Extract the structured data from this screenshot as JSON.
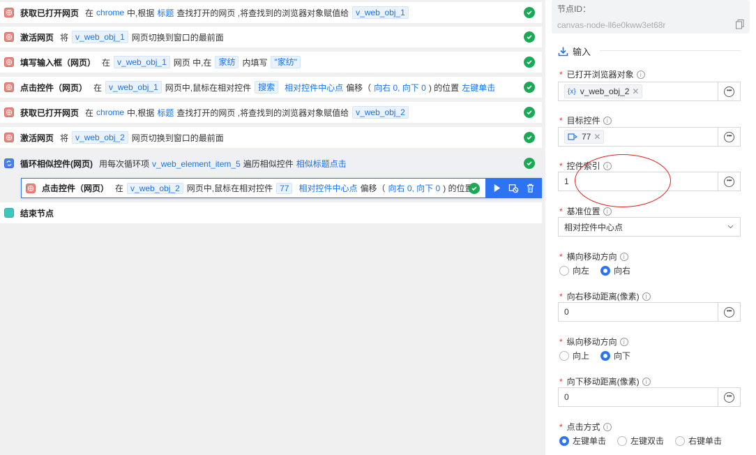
{
  "flow": {
    "rows": [
      {
        "title": "获取已打开网页",
        "parts": [
          [
            "t",
            "在"
          ],
          [
            "lnk",
            "chrome"
          ],
          [
            "t",
            "中,根据"
          ],
          [
            "lnk",
            "标题"
          ],
          [
            "t",
            "查找打开的网页 ,将查找到的浏览器对象赋值给"
          ],
          [
            "tag",
            "v_web_obj_1"
          ]
        ]
      },
      {
        "title": "激活网页",
        "parts": [
          [
            "t",
            "将"
          ],
          [
            "tag",
            "v_web_obj_1"
          ],
          [
            "t",
            "网页切换到窗口的最前面"
          ]
        ]
      },
      {
        "title": "填写输入框（网页）",
        "parts": [
          [
            "t",
            "在"
          ],
          [
            "tag",
            "v_web_obj_1"
          ],
          [
            "t",
            "网页 中,在"
          ],
          [
            "tag",
            "家纺"
          ],
          [
            "t",
            "内填写"
          ],
          [
            "tag",
            "\"家纺\""
          ]
        ]
      },
      {
        "title": "点击控件（网页）",
        "parts": [
          [
            "t",
            "在"
          ],
          [
            "tag",
            "v_web_obj_1"
          ],
          [
            "t",
            "网页中,鼠标在相对控件"
          ],
          [
            "tag",
            "搜索"
          ],
          [
            "lnk",
            "相对控件中心点"
          ],
          [
            "t",
            "偏移（"
          ],
          [
            "lnk",
            "向右 0, 向下 0"
          ],
          [
            "t",
            ") 的位置"
          ],
          [
            "lnk",
            "左键单击"
          ]
        ]
      },
      {
        "title": "获取已打开网页",
        "parts": [
          [
            "t",
            "在"
          ],
          [
            "lnk",
            "chrome"
          ],
          [
            "t",
            "中,根据"
          ],
          [
            "lnk",
            "标题"
          ],
          [
            "t",
            "查找打开的网页 ,将查找到的浏览器对象赋值给"
          ],
          [
            "tag",
            "v_web_obj_2"
          ]
        ]
      },
      {
        "title": "激活网页",
        "parts": [
          [
            "t",
            "将"
          ],
          [
            "tag",
            "v_web_obj_2"
          ],
          [
            "t",
            "网页切换到窗口的最前面"
          ]
        ]
      }
    ],
    "loop": {
      "title": "循环相似控件(网页)",
      "parts": [
        [
          "t",
          "用每次循环项"
        ],
        [
          "lnk",
          "v_web_element_item_5"
        ],
        [
          "t",
          "遍历相似控件"
        ],
        [
          "lnk",
          "相似标题点击"
        ]
      ]
    },
    "selected": {
      "title": "点击控件（网页）",
      "parts": [
        [
          "t",
          "在"
        ],
        [
          "tag",
          "v_web_obj_2"
        ],
        [
          "t",
          "网页中,鼠标在相对控件"
        ],
        [
          "tag",
          "77"
        ],
        [
          "lnk",
          "相对控件中心点"
        ],
        [
          "t",
          "偏移（"
        ],
        [
          "lnk",
          "向右 0, 向下 0"
        ],
        [
          "t",
          ") 的位置..."
        ]
      ]
    },
    "end": {
      "title": "结束节点"
    }
  },
  "panel": {
    "node_id_label": "节点ID：",
    "node_id_value": "canvas-node-ll6e0kww3et68r",
    "section_input": "输入",
    "browser_label": "已打开浏览器对象",
    "browser_chip": "v_web_obj_2",
    "browser_chip_icon": "{x}",
    "target_label": "目标控件",
    "target_chip": "77",
    "index_label": "控件索引",
    "index_value": "1",
    "base_label": "基准位置",
    "base_value": "相对控件中心点",
    "hdir_label": "横向移动方向",
    "hdir_left": "向左",
    "hdir_right": "向右",
    "hdist_label": "向右移动距离(像素)",
    "hdist_value": "0",
    "vdir_label": "纵向移动方向",
    "vdir_up": "向上",
    "vdir_down": "向下",
    "vdist_label": "向下移动距离(像素)",
    "vdist_value": "0",
    "click_label": "点击方式",
    "click_left": "左键单击",
    "click_double": "左键双击",
    "click_right": "右键单击",
    "ellipse_color": "#e02020",
    "accent": "#2d74f5"
  }
}
